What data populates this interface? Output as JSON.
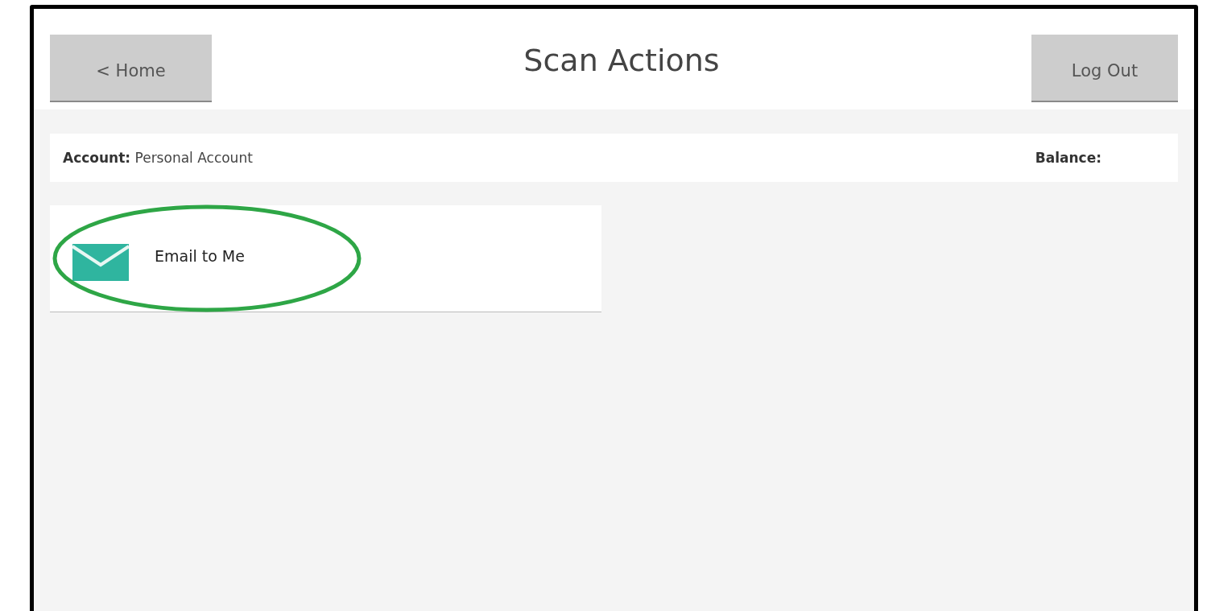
{
  "header": {
    "back_button": "< Home",
    "title": "Scan Actions",
    "logout_button": "Log Out"
  },
  "account_bar": {
    "account_label": "Account:",
    "account_value": "Personal Account",
    "balance_label": "Balance:"
  },
  "actions": [
    {
      "kind": "email",
      "label": "Email to Me",
      "highlighted": true
    }
  ]
}
